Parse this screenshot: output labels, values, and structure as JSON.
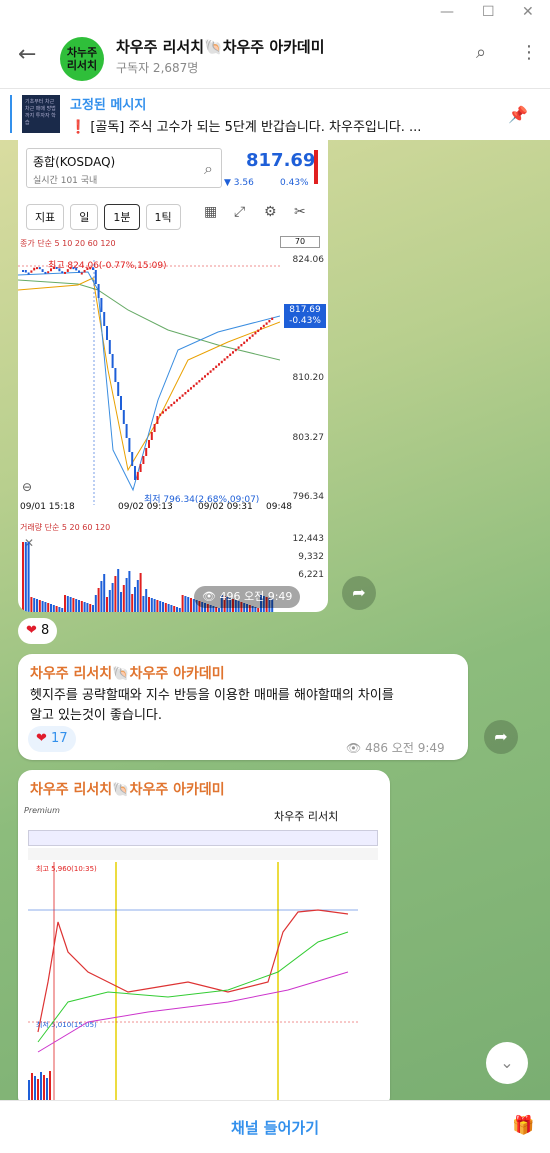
{
  "window": {
    "minimize": "—",
    "maximize": "☐",
    "close": "✕"
  },
  "header": {
    "back_icon": "arrow-left-icon",
    "avatar_text_1": "차누주",
    "avatar_text_2": "리서치",
    "title": "차우주 리서치🐚차우주 아카데미",
    "subtitle": "구독자 2,687명",
    "search_icon": "search-icon",
    "more_icon": "more-vertical-icon"
  },
  "pinned": {
    "title": "고정된 메시지",
    "text": "❗ [골독] 주식 고수가 되는 5단계 반갑습니다. 차우주입니다. ...",
    "thumb_text": "기초부터 차근차근 매매 방법까지 투자자 학습",
    "pin_icon": "pin-icon"
  },
  "chart1": {
    "name": "종합(KOSDAQ)",
    "sub1": "실시간",
    "sub2": "101",
    "sub3": "국내",
    "price": "817.69",
    "change": "▼ 3.56",
    "pct": "0.43%",
    "buttons": [
      "지표",
      "일",
      "1분",
      "1틱"
    ],
    "ma_label": "종가 단순 5 10 20 60 120",
    "box_val": "70",
    "high_label": "최고 824.06(-0.77%,15:09)",
    "low_label": "최저 796.34(2.68%,09:07)",
    "price_tag_1": "817.69",
    "price_tag_2": "-0.43%",
    "y_ticks": [
      "824.06",
      "810.20",
      "803.27",
      "796.34"
    ],
    "x_ticks": [
      "09/01 15:18",
      "09/02 09:13",
      "09/02 09:31",
      "09:48"
    ],
    "vol_label": "거래량 단순 5 20 60 120",
    "vol_ticks": [
      "12,443",
      "9,332",
      "6,221"
    ],
    "views": "496",
    "time": "오전 9:49"
  },
  "reaction1": {
    "emoji": "❤",
    "count": "8"
  },
  "msg2": {
    "sender": "차우주 리서치🐚차우주 아카데미",
    "text_1": "헷지주를 공략할때와 지수 반등을 이용한 매매를 해야할때의 차이를",
    "text_2": "알고 있는것이 좋습니다.",
    "react_emoji": "❤",
    "react_count": "17",
    "views": "486",
    "time": "오전 9:49"
  },
  "msg3": {
    "sender": "차우주 리서치🐚차우주 아카데미",
    "inner_title": "차우주 리서치",
    "logo": "Premium",
    "high_label": "최고 5,960(10:35)",
    "low_label": "최저 5,010(15:05)"
  },
  "bottom": {
    "join": "채널 들어가기",
    "gift_icon": "gift-icon"
  },
  "colors": {
    "accent": "#3390ec",
    "sender": "#e0742f",
    "up": "#e02020",
    "down": "#1e5fd8"
  }
}
